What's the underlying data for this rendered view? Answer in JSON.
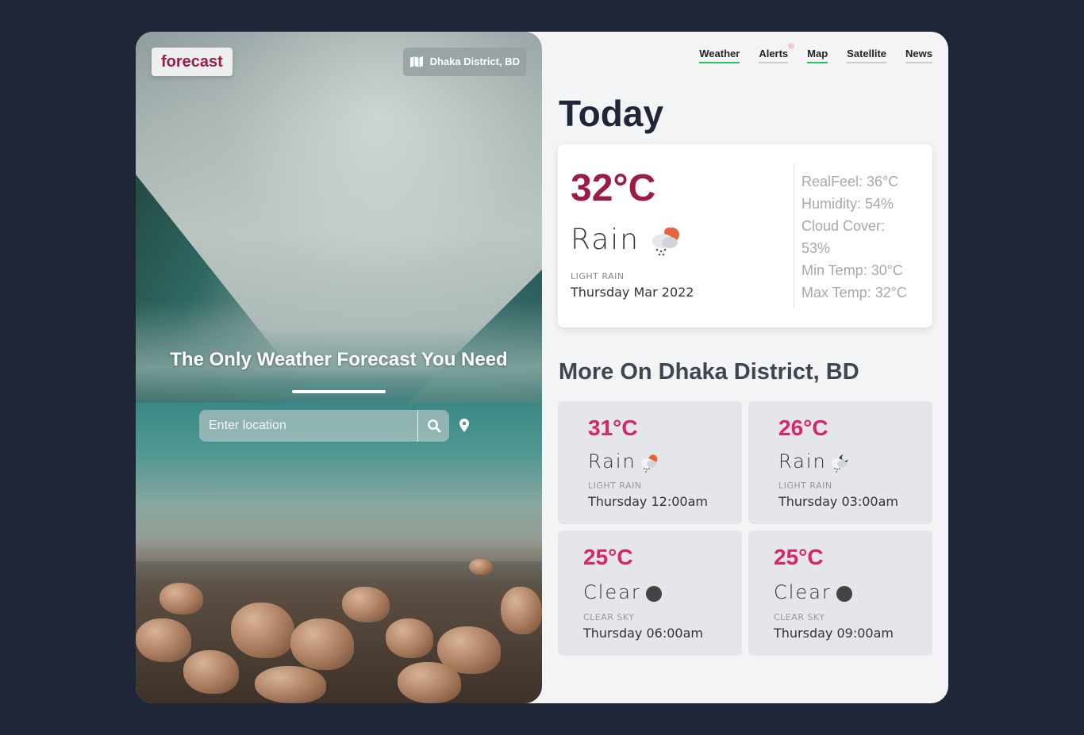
{
  "brand": "forecast",
  "location_chip": {
    "icon": "map-icon",
    "label": "Dhaka District, BD"
  },
  "hero": {
    "tagline": "The Only Weather Forecast You Need",
    "search_placeholder": "Enter location",
    "search_icon": "search-icon",
    "location_icon": "map-pin-icon"
  },
  "nav": {
    "items": [
      {
        "label": "Weather"
      },
      {
        "label": "Alerts"
      },
      {
        "label": "Map"
      },
      {
        "label": "Satellite"
      },
      {
        "label": "News"
      }
    ],
    "accent": "#22c55e"
  },
  "today": {
    "title": "Today",
    "temperature": "32°C",
    "condition": "Rain",
    "condition_icon": "rain-cloud-icon",
    "description": "LIGHT RAIN",
    "date": "Thursday Mar 2022",
    "details": {
      "realfeel": "RealFeel: 36°C",
      "humidity": "Humidity: 54%",
      "cloud_cover_1": "Cloud Cover:",
      "cloud_cover_2": "53%",
      "min_temp": "Min Temp: 30°C",
      "max_temp": "Max Temp: 32°C"
    }
  },
  "more": {
    "title": "More On Dhaka District, BD",
    "cards": [
      {
        "temperature": "31°C",
        "condition": "Rain",
        "icon": "rain-cloud-icon",
        "description": "LIGHT RAIN",
        "time": "Thursday 12:00am"
      },
      {
        "temperature": "26°C",
        "condition": "Rain",
        "icon": "rain-cloud-night-icon",
        "description": "LIGHT RAIN",
        "time": "Thursday 03:00am"
      },
      {
        "temperature": "25°C",
        "condition": "Clear",
        "icon": "moon-icon",
        "description": "CLEAR SKY",
        "time": "Thursday 06:00am"
      },
      {
        "temperature": "25°C",
        "condition": "Clear",
        "icon": "moon-icon",
        "description": "CLEAR SKY",
        "time": "Thursday 09:00am"
      }
    ]
  },
  "colors": {
    "background": "#1f2637",
    "brand": "#9b1b4a",
    "forecast_temp": "#d6266a",
    "panel": "#f3f4f6"
  }
}
